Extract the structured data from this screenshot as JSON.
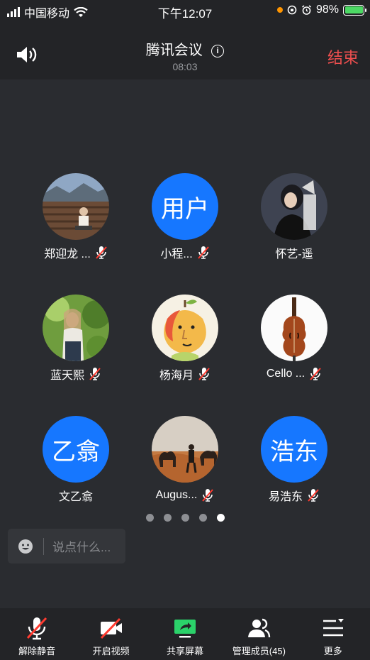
{
  "status_bar": {
    "carrier": "中国移动",
    "time": "下午12:07",
    "battery": "98%"
  },
  "header": {
    "title": "腾讯会议",
    "timer": "08:03",
    "end_label": "结束"
  },
  "participants": [
    {
      "name": "郑迎龙 ...",
      "avatar_type": "photo",
      "muted": true
    },
    {
      "name": "小程...",
      "avatar_type": "text",
      "avatar_text": "用户",
      "muted": true
    },
    {
      "name": "怀艺-遥",
      "avatar_type": "photo",
      "muted": false
    },
    {
      "name": "蓝天熙",
      "avatar_type": "photo",
      "muted": true
    },
    {
      "name": "杨海月",
      "avatar_type": "photo",
      "muted": true
    },
    {
      "name": "Cello ...",
      "avatar_type": "photo",
      "muted": true
    },
    {
      "name": "文乙翕",
      "avatar_type": "text",
      "avatar_text": "乙翕",
      "muted": false
    },
    {
      "name": "Augus...",
      "avatar_type": "photo",
      "muted": true
    },
    {
      "name": "易浩东",
      "avatar_type": "text",
      "avatar_text": "浩东",
      "muted": true
    }
  ],
  "pagination": {
    "total": 5,
    "current": 5
  },
  "chat": {
    "placeholder": "说点什么..."
  },
  "toolbar": {
    "unmute": "解除静音",
    "start_video": "开启视频",
    "share_screen": "共享屏幕",
    "manage_members": "管理成员(45)",
    "more": "更多"
  },
  "colors": {
    "accent_blue": "#1677ff",
    "end_red": "#ef4f4f",
    "mute_red": "#ff3b30",
    "share_green": "#2bd26a"
  }
}
